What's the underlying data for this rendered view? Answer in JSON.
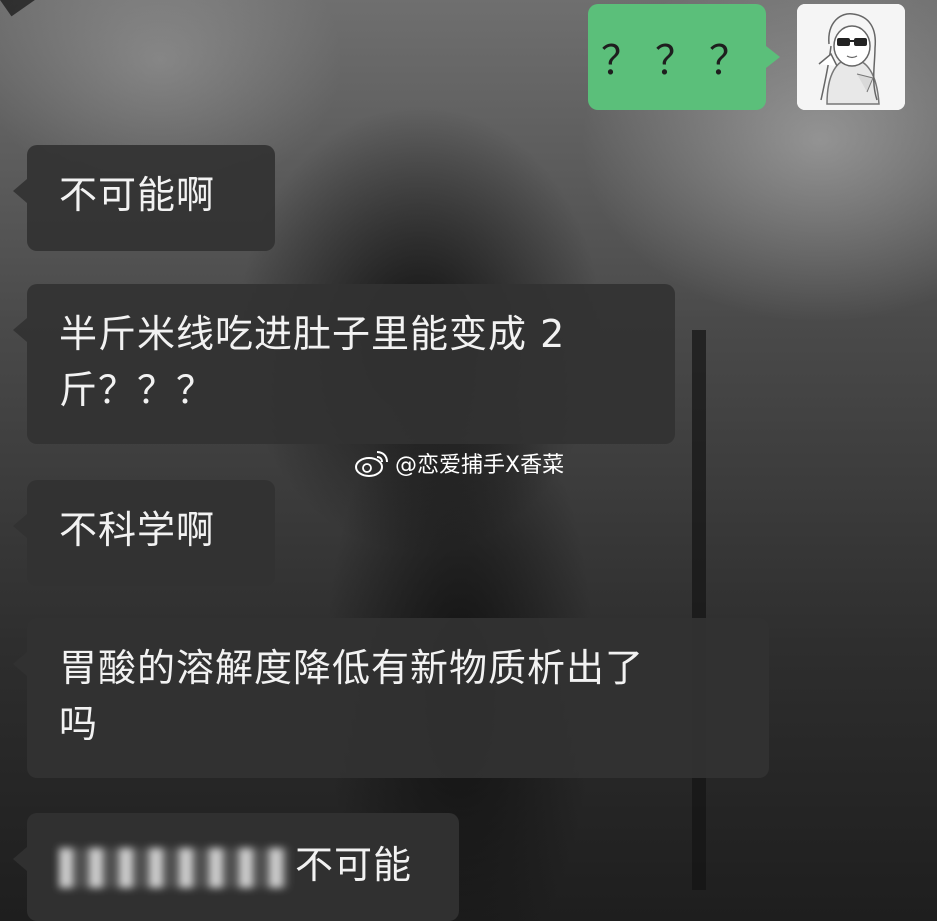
{
  "sent": {
    "text": "？？？"
  },
  "received": [
    {
      "text": "不可能啊"
    },
    {
      "text": "半斤米线吃进肚子里能变成 2"
    },
    {
      "text": "斤？？？"
    },
    {
      "text": "不科学啊"
    },
    {
      "text": "胃酸的溶解度降低有新物质析出了"
    },
    {
      "text": "吗"
    },
    {
      "text": "不可能"
    }
  ],
  "watermark": {
    "text": "@恋爱捕手X香菜"
  },
  "colors": {
    "sent_bubble": "#5bbf7a",
    "received_bubble": "#323232"
  }
}
